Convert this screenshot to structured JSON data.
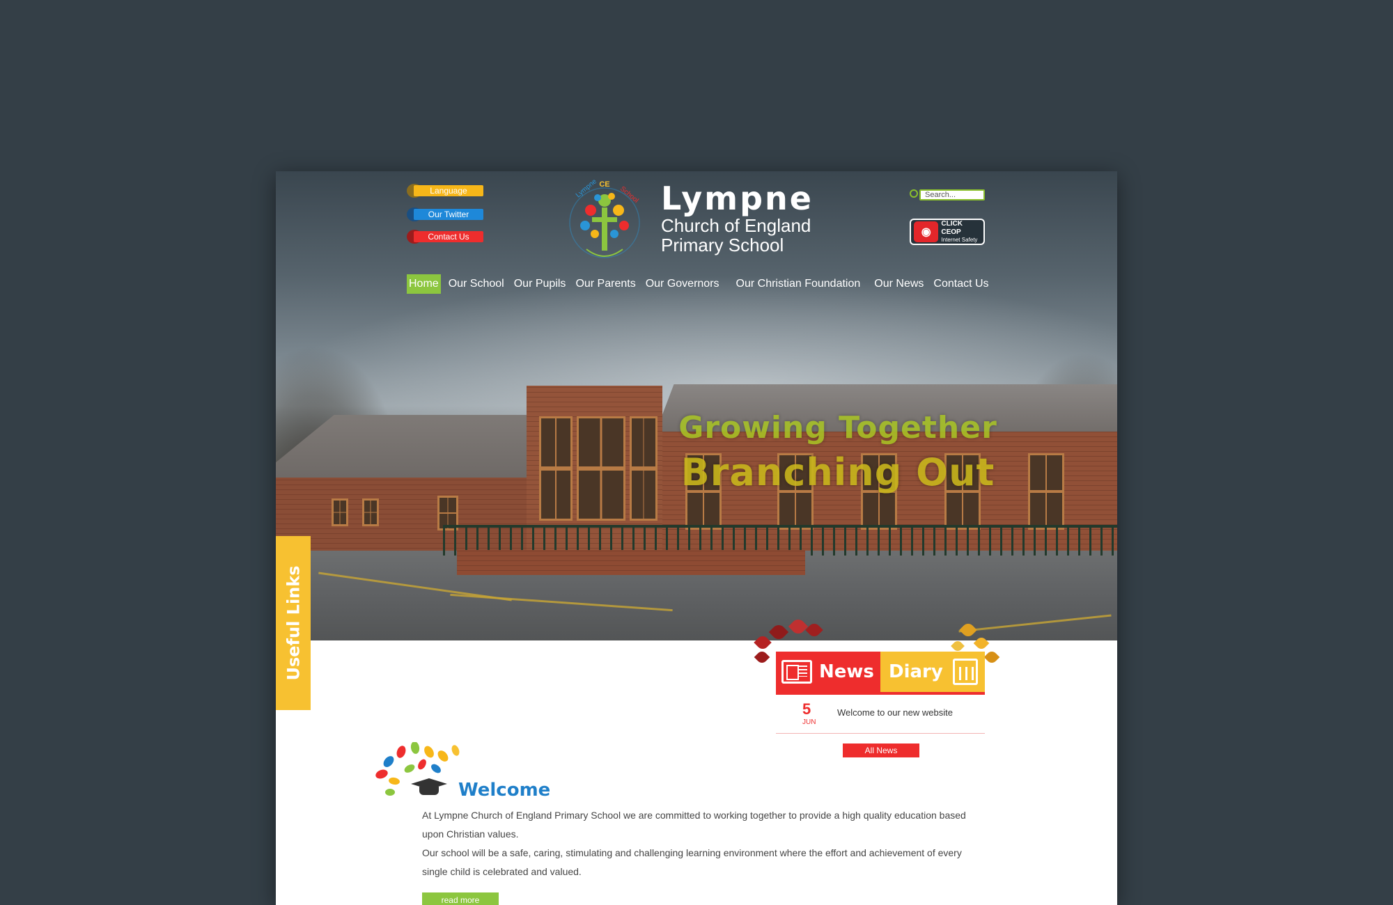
{
  "header": {
    "links": [
      {
        "label": "Language",
        "color": "#f7b719"
      },
      {
        "label": "Our Twitter",
        "color": "#1e88d9"
      },
      {
        "label": "Contact Us",
        "color": "#ee2d2d"
      }
    ],
    "logo_ring_text": "Lympne CE School",
    "logo_motto": "Growing Together · Branching Out",
    "school_name": "Lympne",
    "school_subtitle_1": "Church of England",
    "school_subtitle_2": "Primary School",
    "search_placeholder": "Search...",
    "ceop": {
      "line1": "CLICK CEOP",
      "line2": "Internet Safety"
    }
  },
  "nav": {
    "items": [
      "Home",
      "Our School",
      "Our Pupils",
      "Our Parents",
      "Our Governors",
      "Our Christian Foundation",
      "Our News",
      "Contact Us"
    ],
    "active": "Home",
    "active_color": "#8cc63f"
  },
  "hero": {
    "slogan_line1": "Growing Together",
    "slogan_line2": "Branching Out"
  },
  "sidebar": {
    "useful_links_label": "Useful Links"
  },
  "widget": {
    "tab_news": "News",
    "tab_diary": "Diary",
    "news_items": [
      {
        "day": "5",
        "month": "JUN",
        "title": "Welcome to our new website"
      }
    ],
    "all_news_label": "All News"
  },
  "welcome": {
    "title": "Welcome",
    "paragraph_1": "At Lympne Church of England Primary School we are committed to working together to provide a high quality education based upon Christian values.",
    "paragraph_2": "Our school will be a safe, caring, stimulating and challenging learning environment where the effort and achievement of every single child is celebrated and valued.",
    "read_more_label": "read more"
  },
  "colors": {
    "page_background": "#343f47",
    "red": "#ee2d2d",
    "yellow": "#f7c131",
    "green": "#8cc63f",
    "blue": "#1f7fc9"
  }
}
